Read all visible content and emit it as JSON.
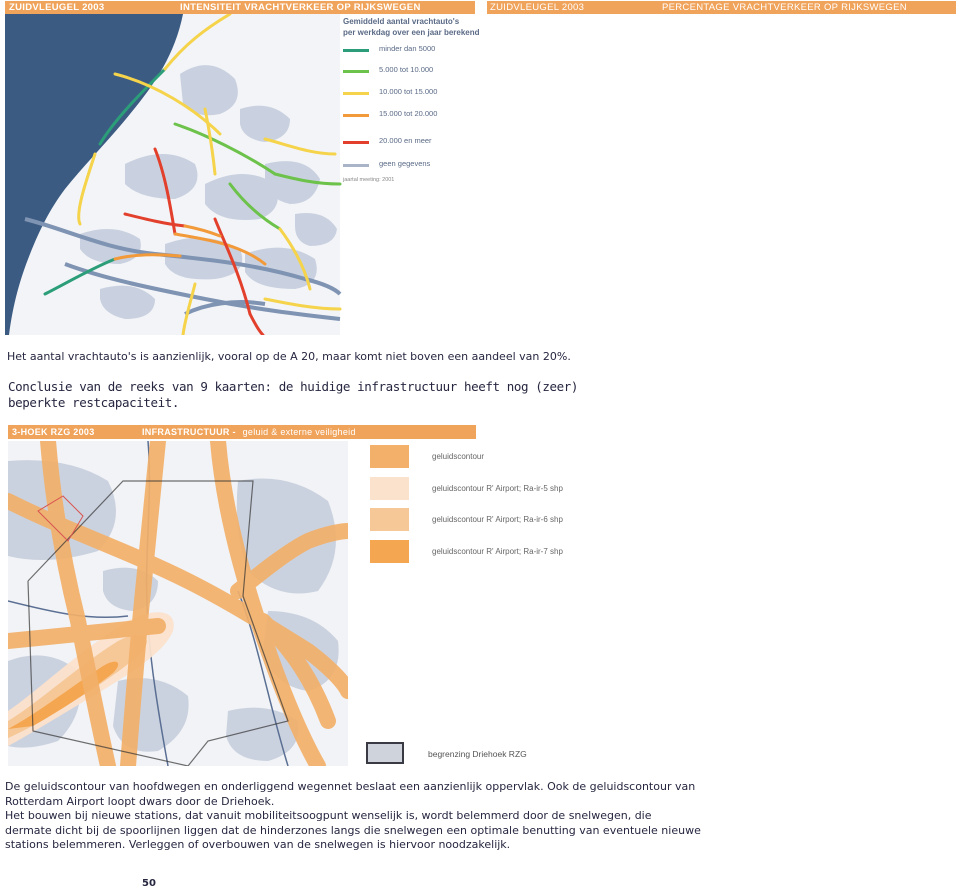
{
  "top_left_bar": {
    "left": "ZUIDVLEUGEL 2003",
    "right": "INTENSITEIT VRACHTVERKEER OP RIJKSWEGEN"
  },
  "top_right_bar": {
    "left": "ZUIDVLEUGEL 2003",
    "right": "PERCENTAGE VRACHTVERKEER OP RIJKSWEGEN"
  },
  "map1_legend": {
    "title_line1": "Gemiddeld aantal vrachtauto's",
    "title_line2": "per werkdag over een jaar berekend",
    "items": [
      {
        "label": "minder dan 5000",
        "color": "#2b9e79"
      },
      {
        "label": "5.000 tot 10.000",
        "color": "#6cc24a"
      },
      {
        "label": "10.000 tot 15.000",
        "color": "#f5d34a"
      },
      {
        "label": "15.000 tot 20.000",
        "color": "#f29a3a"
      },
      {
        "label": "20.000 en meer",
        "color": "#e2402c"
      },
      {
        "label": "geen gegevens",
        "color": "#aab4c8"
      }
    ],
    "note": "jaartal meeting: 2001"
  },
  "caption1": "Het aantal vrachtauto's is aanzienlijk, vooral op de A 20, maar komt niet boven een aandeel van 20%.",
  "conclusion_line1": "Conclusie van de reeks van 9 kaarten: de huidige infrastructuur heeft nog (zeer)",
  "conclusion_line2": "beperkte restcapaciteit.",
  "mid_bar": {
    "left": "3-HOEK RZG 2003",
    "right_bold": "INFRASTRUCTUUR -",
    "right_rest": "geluid & externe veiligheid"
  },
  "map2_legend": {
    "items": [
      {
        "label": "geluidscontour",
        "color": "#f2b06a"
      },
      {
        "label": "geluidscontour R' Airport; Ra-ir-5 shp",
        "color": "#fbe2cc"
      },
      {
        "label": "geluidscontour R' Airport; Ra-ir-6 shp",
        "color": "#f6c898"
      },
      {
        "label": "geluidscontour R' Airport; Ra-ir-7 shp",
        "color": "#f5a650"
      }
    ],
    "boundary": "begrenzing Driehoek RZG"
  },
  "body_lines": [
    "De geluidscontour van hoofdwegen en onderliggend wegennet beslaat een aanzienlijk oppervlak. Ook de geluidscontour van",
    "Rotterdam Airport loopt dwars door de Driehoek.",
    "Het bouwen bij nieuwe stations, dat vanuit mobiliteitsoogpunt wenselijk is, wordt belemmerd door de snelwegen, die",
    "dermate dicht bij de spoorlijnen liggen dat de hinderzones langs die snelwegen een optimale benutting van eventuele nieuwe",
    "stations belemmeren. Verleggen of overbouwen van de snelwegen is hiervoor noodzakelijk."
  ],
  "page_number": "50"
}
